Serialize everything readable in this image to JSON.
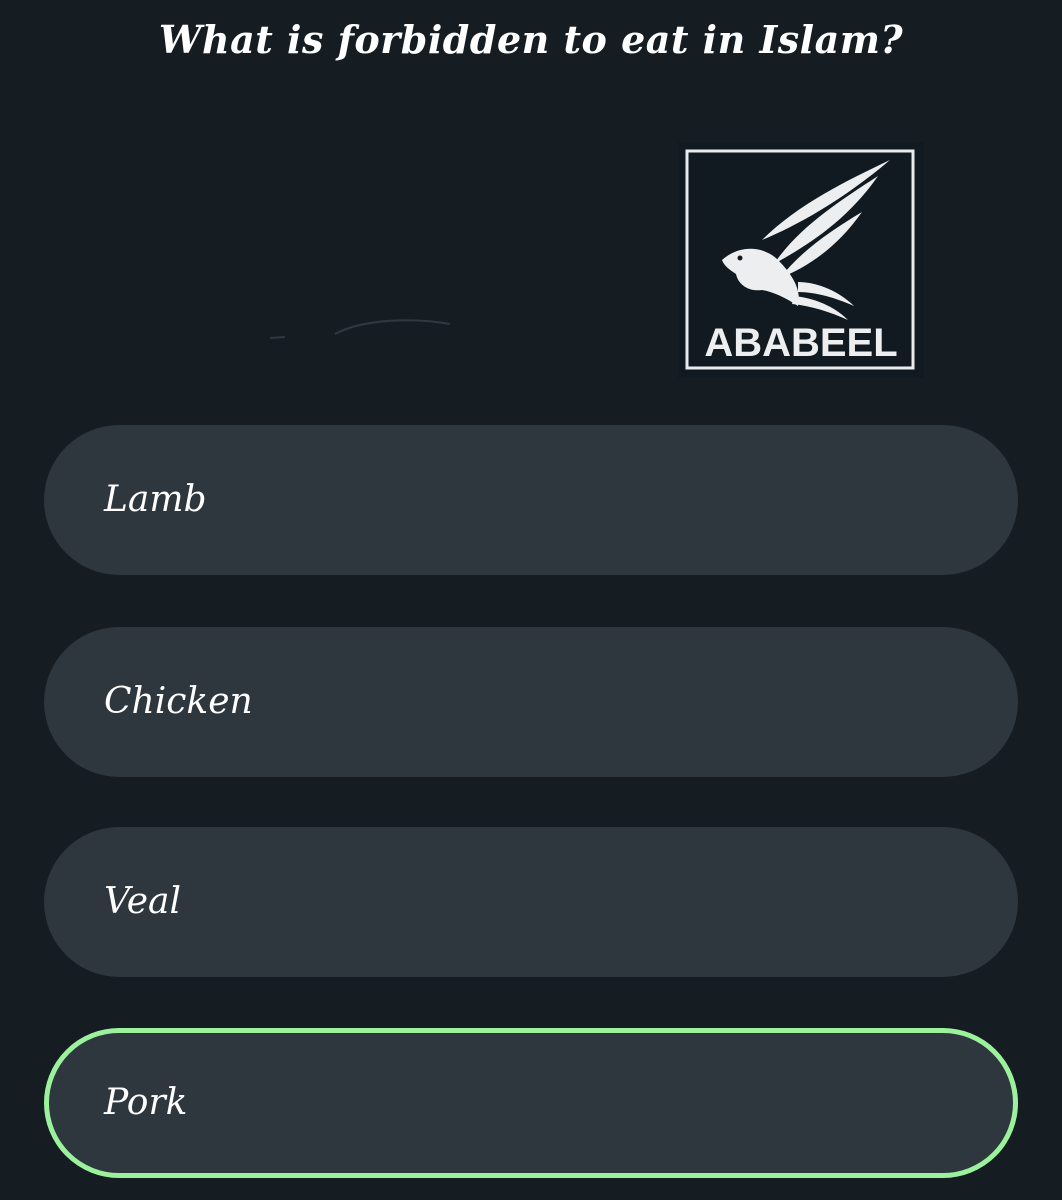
{
  "question": {
    "text": "What is forbidden to eat in Islam?"
  },
  "logo": {
    "text": "ABABEEL",
    "icon": "bird-icon"
  },
  "options": [
    {
      "label": "Lamb",
      "selected": false
    },
    {
      "label": "Chicken",
      "selected": false
    },
    {
      "label": "Veal",
      "selected": false
    },
    {
      "label": "Pork",
      "selected": true
    }
  ],
  "colors": {
    "background": "#151d23",
    "option_background": "#2e363e",
    "selected_border": "#9cf29c",
    "text": "#ffffff"
  }
}
